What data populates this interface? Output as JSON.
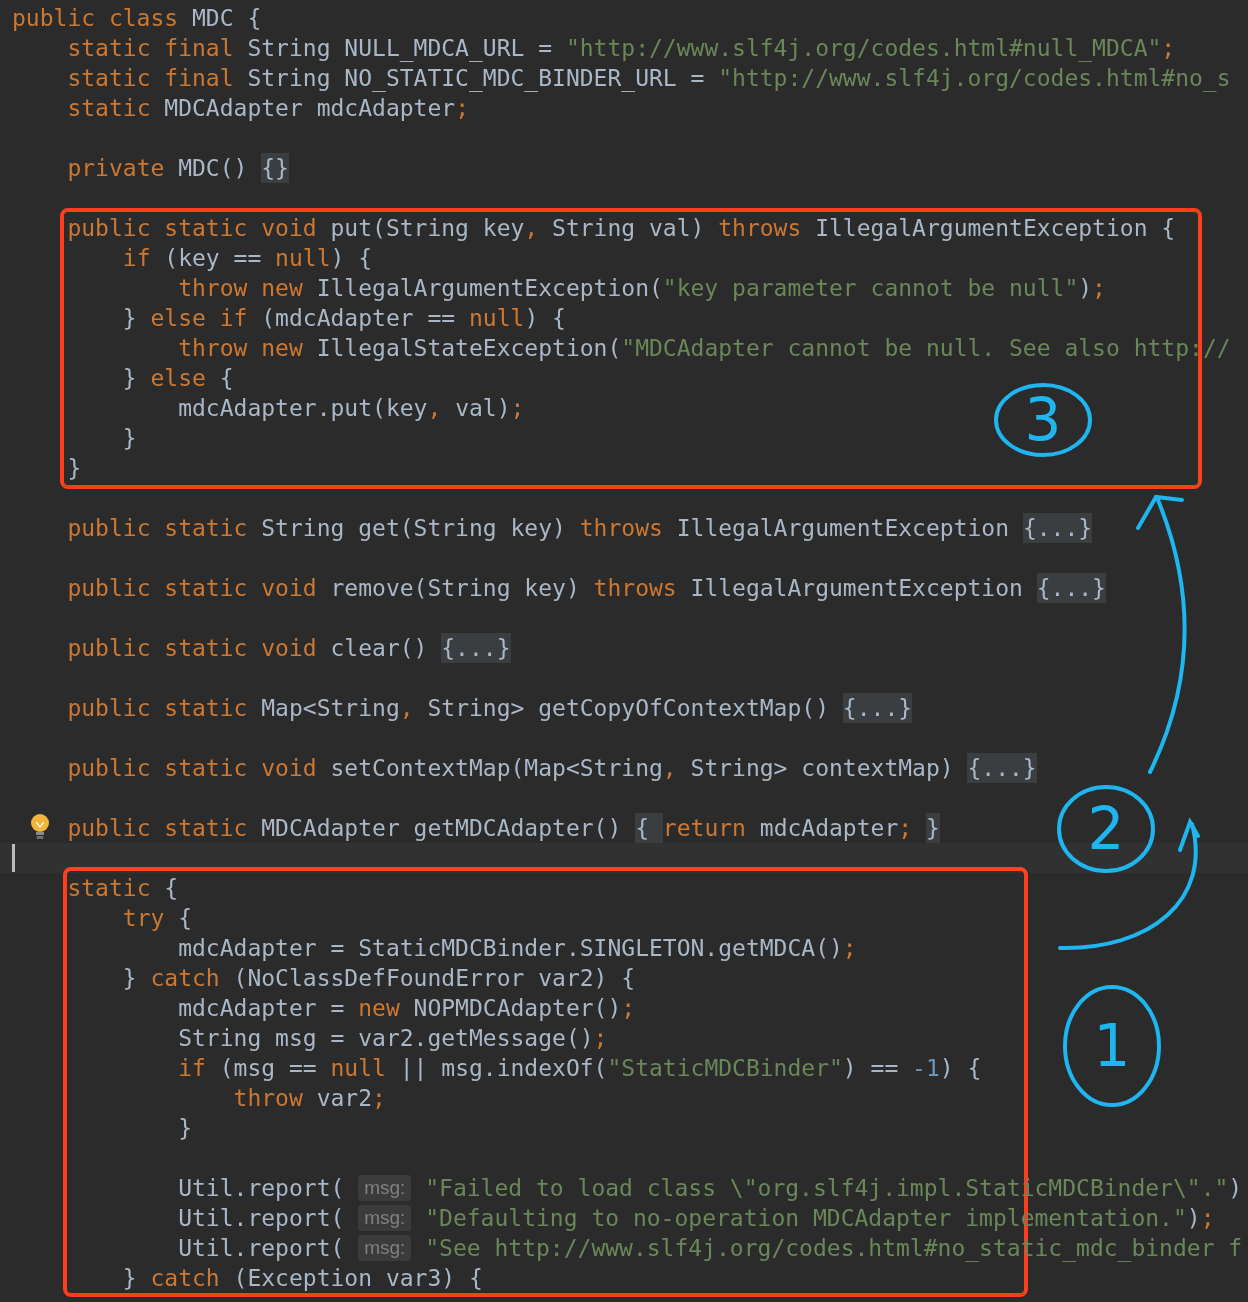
{
  "editor": {
    "lines": [
      {
        "current": false,
        "tokens": [
          {
            "kind": "keyword",
            "text": "public class"
          },
          {
            "kind": "plain",
            "text": " MDC {"
          }
        ]
      },
      {
        "current": false,
        "tokens": [
          {
            "kind": "keyword",
            "text": "    static final"
          },
          {
            "kind": "plain",
            "text": " String NULL_MDCA_URL = "
          },
          {
            "kind": "string",
            "text": "\"http://www.slf4j.org/codes.html#null_MDCA\""
          },
          {
            "kind": "punct",
            "text": ";"
          }
        ]
      },
      {
        "current": false,
        "tokens": [
          {
            "kind": "keyword",
            "text": "    static final"
          },
          {
            "kind": "plain",
            "text": " String NO_STATIC_MDC_BINDER_URL = "
          },
          {
            "kind": "string",
            "text": "\"http://www.slf4j.org/codes.html#no_s"
          }
        ]
      },
      {
        "current": false,
        "tokens": [
          {
            "kind": "keyword",
            "text": "    static"
          },
          {
            "kind": "plain",
            "text": " MDCAdapter mdcAdapter"
          },
          {
            "kind": "punct",
            "text": ";"
          }
        ]
      },
      {
        "current": false
      },
      {
        "current": false,
        "tokens": [
          {
            "kind": "keyword",
            "text": "    private"
          },
          {
            "kind": "plain",
            "text": " MDC() "
          },
          {
            "kind": "fold",
            "text": "{}"
          }
        ]
      },
      {
        "current": false
      },
      {
        "current": false,
        "tokens": [
          {
            "kind": "keyword",
            "text": "    public static void"
          },
          {
            "kind": "plain",
            "text": " put(String key"
          },
          {
            "kind": "punct",
            "text": ", "
          },
          {
            "kind": "plain",
            "text": "String val) "
          },
          {
            "kind": "keyword",
            "text": "throws"
          },
          {
            "kind": "plain",
            "text": " IllegalArgumentException {"
          }
        ]
      },
      {
        "current": false,
        "tokens": [
          {
            "kind": "keyword",
            "text": "        if"
          },
          {
            "kind": "plain",
            "text": " (key == "
          },
          {
            "kind": "keyword",
            "text": "null"
          },
          {
            "kind": "plain",
            "text": ") {"
          }
        ]
      },
      {
        "current": false,
        "tokens": [
          {
            "kind": "keyword",
            "text": "            throw new"
          },
          {
            "kind": "plain",
            "text": " IllegalArgumentException("
          },
          {
            "kind": "string",
            "text": "\"key parameter cannot be null\""
          },
          {
            "kind": "plain",
            "text": ")"
          },
          {
            "kind": "punct",
            "text": ";"
          }
        ]
      },
      {
        "current": false,
        "tokens": [
          {
            "kind": "plain",
            "text": "        } "
          },
          {
            "kind": "keyword",
            "text": "else if"
          },
          {
            "kind": "plain",
            "text": " (mdcAdapter == "
          },
          {
            "kind": "keyword",
            "text": "null"
          },
          {
            "kind": "plain",
            "text": ") {"
          }
        ]
      },
      {
        "current": false,
        "tokens": [
          {
            "kind": "keyword",
            "text": "            throw new"
          },
          {
            "kind": "plain",
            "text": " IllegalStateException("
          },
          {
            "kind": "string",
            "text": "\"MDCAdapter cannot be null. See also http://"
          }
        ]
      },
      {
        "current": false,
        "tokens": [
          {
            "kind": "plain",
            "text": "        } "
          },
          {
            "kind": "keyword",
            "text": "else"
          },
          {
            "kind": "plain",
            "text": " {"
          }
        ]
      },
      {
        "current": false,
        "tokens": [
          {
            "kind": "plain",
            "text": "            mdcAdapter.put(key"
          },
          {
            "kind": "punct",
            "text": ", "
          },
          {
            "kind": "plain",
            "text": "val)"
          },
          {
            "kind": "punct",
            "text": ";"
          }
        ]
      },
      {
        "current": false,
        "tokens": [
          {
            "kind": "plain",
            "text": "        }"
          }
        ]
      },
      {
        "current": false,
        "tokens": [
          {
            "kind": "plain",
            "text": "    }"
          }
        ]
      },
      {
        "current": false
      },
      {
        "current": false,
        "tokens": [
          {
            "kind": "keyword",
            "text": "    public static"
          },
          {
            "kind": "plain",
            "text": " String get(String key) "
          },
          {
            "kind": "keyword",
            "text": "throws"
          },
          {
            "kind": "plain",
            "text": " IllegalArgumentException "
          },
          {
            "kind": "fold",
            "text": "{...}"
          }
        ]
      },
      {
        "current": false
      },
      {
        "current": false,
        "tokens": [
          {
            "kind": "keyword",
            "text": "    public static void"
          },
          {
            "kind": "plain",
            "text": " remove(String key) "
          },
          {
            "kind": "keyword",
            "text": "throws"
          },
          {
            "kind": "plain",
            "text": " IllegalArgumentException "
          },
          {
            "kind": "fold",
            "text": "{...}"
          }
        ]
      },
      {
        "current": false
      },
      {
        "current": false,
        "tokens": [
          {
            "kind": "keyword",
            "text": "    public static void"
          },
          {
            "kind": "plain",
            "text": " clear() "
          },
          {
            "kind": "fold",
            "text": "{...}"
          }
        ]
      },
      {
        "current": false
      },
      {
        "current": false,
        "tokens": [
          {
            "kind": "keyword",
            "text": "    public static"
          },
          {
            "kind": "plain",
            "text": " Map<String"
          },
          {
            "kind": "punct",
            "text": ", "
          },
          {
            "kind": "plain",
            "text": "String> getCopyOfContextMap() "
          },
          {
            "kind": "fold",
            "text": "{...}"
          }
        ]
      },
      {
        "current": false
      },
      {
        "current": false,
        "tokens": [
          {
            "kind": "keyword",
            "text": "    public static void"
          },
          {
            "kind": "plain",
            "text": " setContextMap(Map<String"
          },
          {
            "kind": "punct",
            "text": ", "
          },
          {
            "kind": "plain",
            "text": "String> contextMap) "
          },
          {
            "kind": "fold",
            "text": "{...}"
          }
        ]
      },
      {
        "current": false
      },
      {
        "current": false,
        "intention_bulb": true,
        "tokens": [
          {
            "kind": "keyword",
            "text": "    public static"
          },
          {
            "kind": "plain",
            "text": " MDCAdapter getMDCAdapter() "
          },
          {
            "kind": "fold",
            "text": "{ "
          },
          {
            "kind": "keyword",
            "text": "return"
          },
          {
            "kind": "plain",
            "text": " mdcAdapter"
          },
          {
            "kind": "punct",
            "text": "; "
          },
          {
            "kind": "fold",
            "text": "}"
          }
        ]
      },
      {
        "current": true
      },
      {
        "current": false,
        "tokens": [
          {
            "kind": "keyword",
            "text": "    static"
          },
          {
            "kind": "plain",
            "text": " {"
          }
        ]
      },
      {
        "current": false,
        "tokens": [
          {
            "kind": "keyword",
            "text": "        try"
          },
          {
            "kind": "plain",
            "text": " {"
          }
        ]
      },
      {
        "current": false,
        "tokens": [
          {
            "kind": "plain",
            "text": "            mdcAdapter = StaticMDCBinder.SINGLETON.getMDCA()"
          },
          {
            "kind": "punct",
            "text": ";"
          }
        ]
      },
      {
        "current": false,
        "tokens": [
          {
            "kind": "plain",
            "text": "        } "
          },
          {
            "kind": "keyword",
            "text": "catch"
          },
          {
            "kind": "plain",
            "text": " (NoClassDefFoundError var2) {"
          }
        ]
      },
      {
        "current": false,
        "tokens": [
          {
            "kind": "plain",
            "text": "            mdcAdapter = "
          },
          {
            "kind": "keyword",
            "text": "new"
          },
          {
            "kind": "plain",
            "text": " NOPMDCAdapter()"
          },
          {
            "kind": "punct",
            "text": ";"
          }
        ]
      },
      {
        "current": false,
        "tokens": [
          {
            "kind": "plain",
            "text": "            String msg = var2.getMessage()"
          },
          {
            "kind": "punct",
            "text": ";"
          }
        ]
      },
      {
        "current": false,
        "tokens": [
          {
            "kind": "keyword",
            "text": "            if"
          },
          {
            "kind": "plain",
            "text": " (msg == "
          },
          {
            "kind": "keyword",
            "text": "null"
          },
          {
            "kind": "plain",
            "text": " || msg.indexOf("
          },
          {
            "kind": "string",
            "text": "\"StaticMDCBinder\""
          },
          {
            "kind": "plain",
            "text": ") == "
          },
          {
            "kind": "number",
            "text": "-1"
          },
          {
            "kind": "plain",
            "text": ") {"
          }
        ]
      },
      {
        "current": false,
        "tokens": [
          {
            "kind": "keyword",
            "text": "                throw"
          },
          {
            "kind": "plain",
            "text": " var2"
          },
          {
            "kind": "punct",
            "text": ";"
          }
        ]
      },
      {
        "current": false,
        "tokens": [
          {
            "kind": "plain",
            "text": "            }"
          }
        ]
      },
      {
        "current": false
      },
      {
        "current": false,
        "tokens": [
          {
            "kind": "plain",
            "text": "            Util.report( "
          },
          {
            "kind": "hint",
            "text": "msg:"
          },
          {
            "kind": "string",
            "text": " \"Failed to load class \\\"org.slf4j.impl.StaticMDCBinder\\\".\""
          },
          {
            "kind": "plain",
            "text": ")"
          }
        ]
      },
      {
        "current": false,
        "tokens": [
          {
            "kind": "plain",
            "text": "            Util.report( "
          },
          {
            "kind": "hint",
            "text": "msg:"
          },
          {
            "kind": "string",
            "text": " \"Defaulting to no-operation MDCAdapter implementation.\""
          },
          {
            "kind": "plain",
            "text": ")"
          },
          {
            "kind": "punct",
            "text": ";"
          }
        ]
      },
      {
        "current": false,
        "tokens": [
          {
            "kind": "plain",
            "text": "            Util.report( "
          },
          {
            "kind": "hint",
            "text": "msg:"
          },
          {
            "kind": "string",
            "text": " \"See http://www.slf4j.org/codes.html#no_static_mdc_binder f"
          }
        ]
      },
      {
        "current": false,
        "tokens": [
          {
            "kind": "plain",
            "text": "        } "
          },
          {
            "kind": "keyword",
            "text": "catch"
          },
          {
            "kind": "plain",
            "text": " (Exception var3) {"
          }
        ]
      }
    ]
  },
  "annotations": {
    "callouts": [
      {
        "label": "3"
      },
      {
        "label": "2"
      },
      {
        "label": "1"
      }
    ]
  }
}
